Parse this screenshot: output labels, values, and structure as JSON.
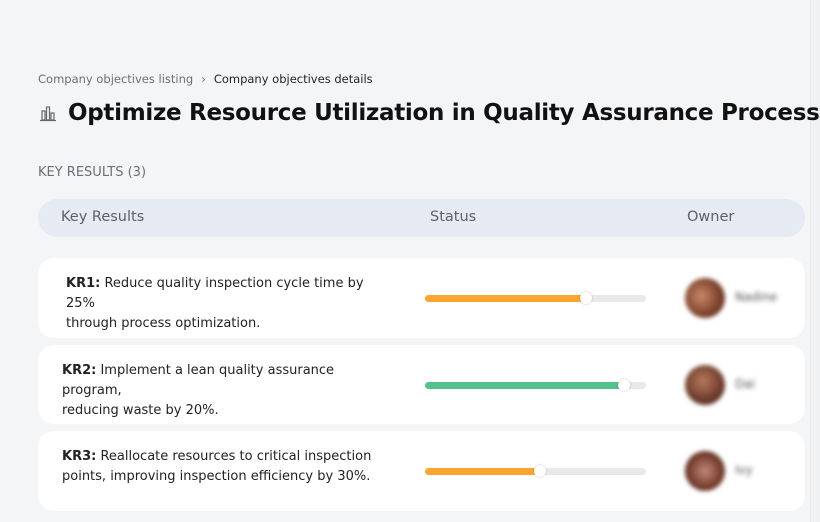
{
  "breadcrumb": {
    "parent": "Company objectives listing",
    "separator": "›",
    "current": "Company objectives details"
  },
  "objective": {
    "icon": "chart-building-icon",
    "title": "Optimize Resource Utilization in Quality Assurance Processes"
  },
  "key_results_label": "KEY RESULTS (3)",
  "table": {
    "headers": [
      "Key Results",
      "Status",
      "Owner"
    ]
  },
  "rows": [
    {
      "code": "KR1:",
      "line1": "Reduce quality inspection cycle time by 25%",
      "line2": "through process optimization.",
      "progress": 73,
      "color": "#fba631",
      "owner": "Nadine"
    },
    {
      "code": "KR2:",
      "line1": "Implement a lean quality assurance program,",
      "line2": "reducing waste by 20%.",
      "progress": 90,
      "color": "#55c18b",
      "owner": "Dai"
    },
    {
      "code": "KR3:",
      "line1": "Reallocate resources to critical inspection",
      "line2": "points, improving inspection efficiency by 30%.",
      "progress": 52,
      "color": "#fba631",
      "owner": "Ivy"
    }
  ]
}
